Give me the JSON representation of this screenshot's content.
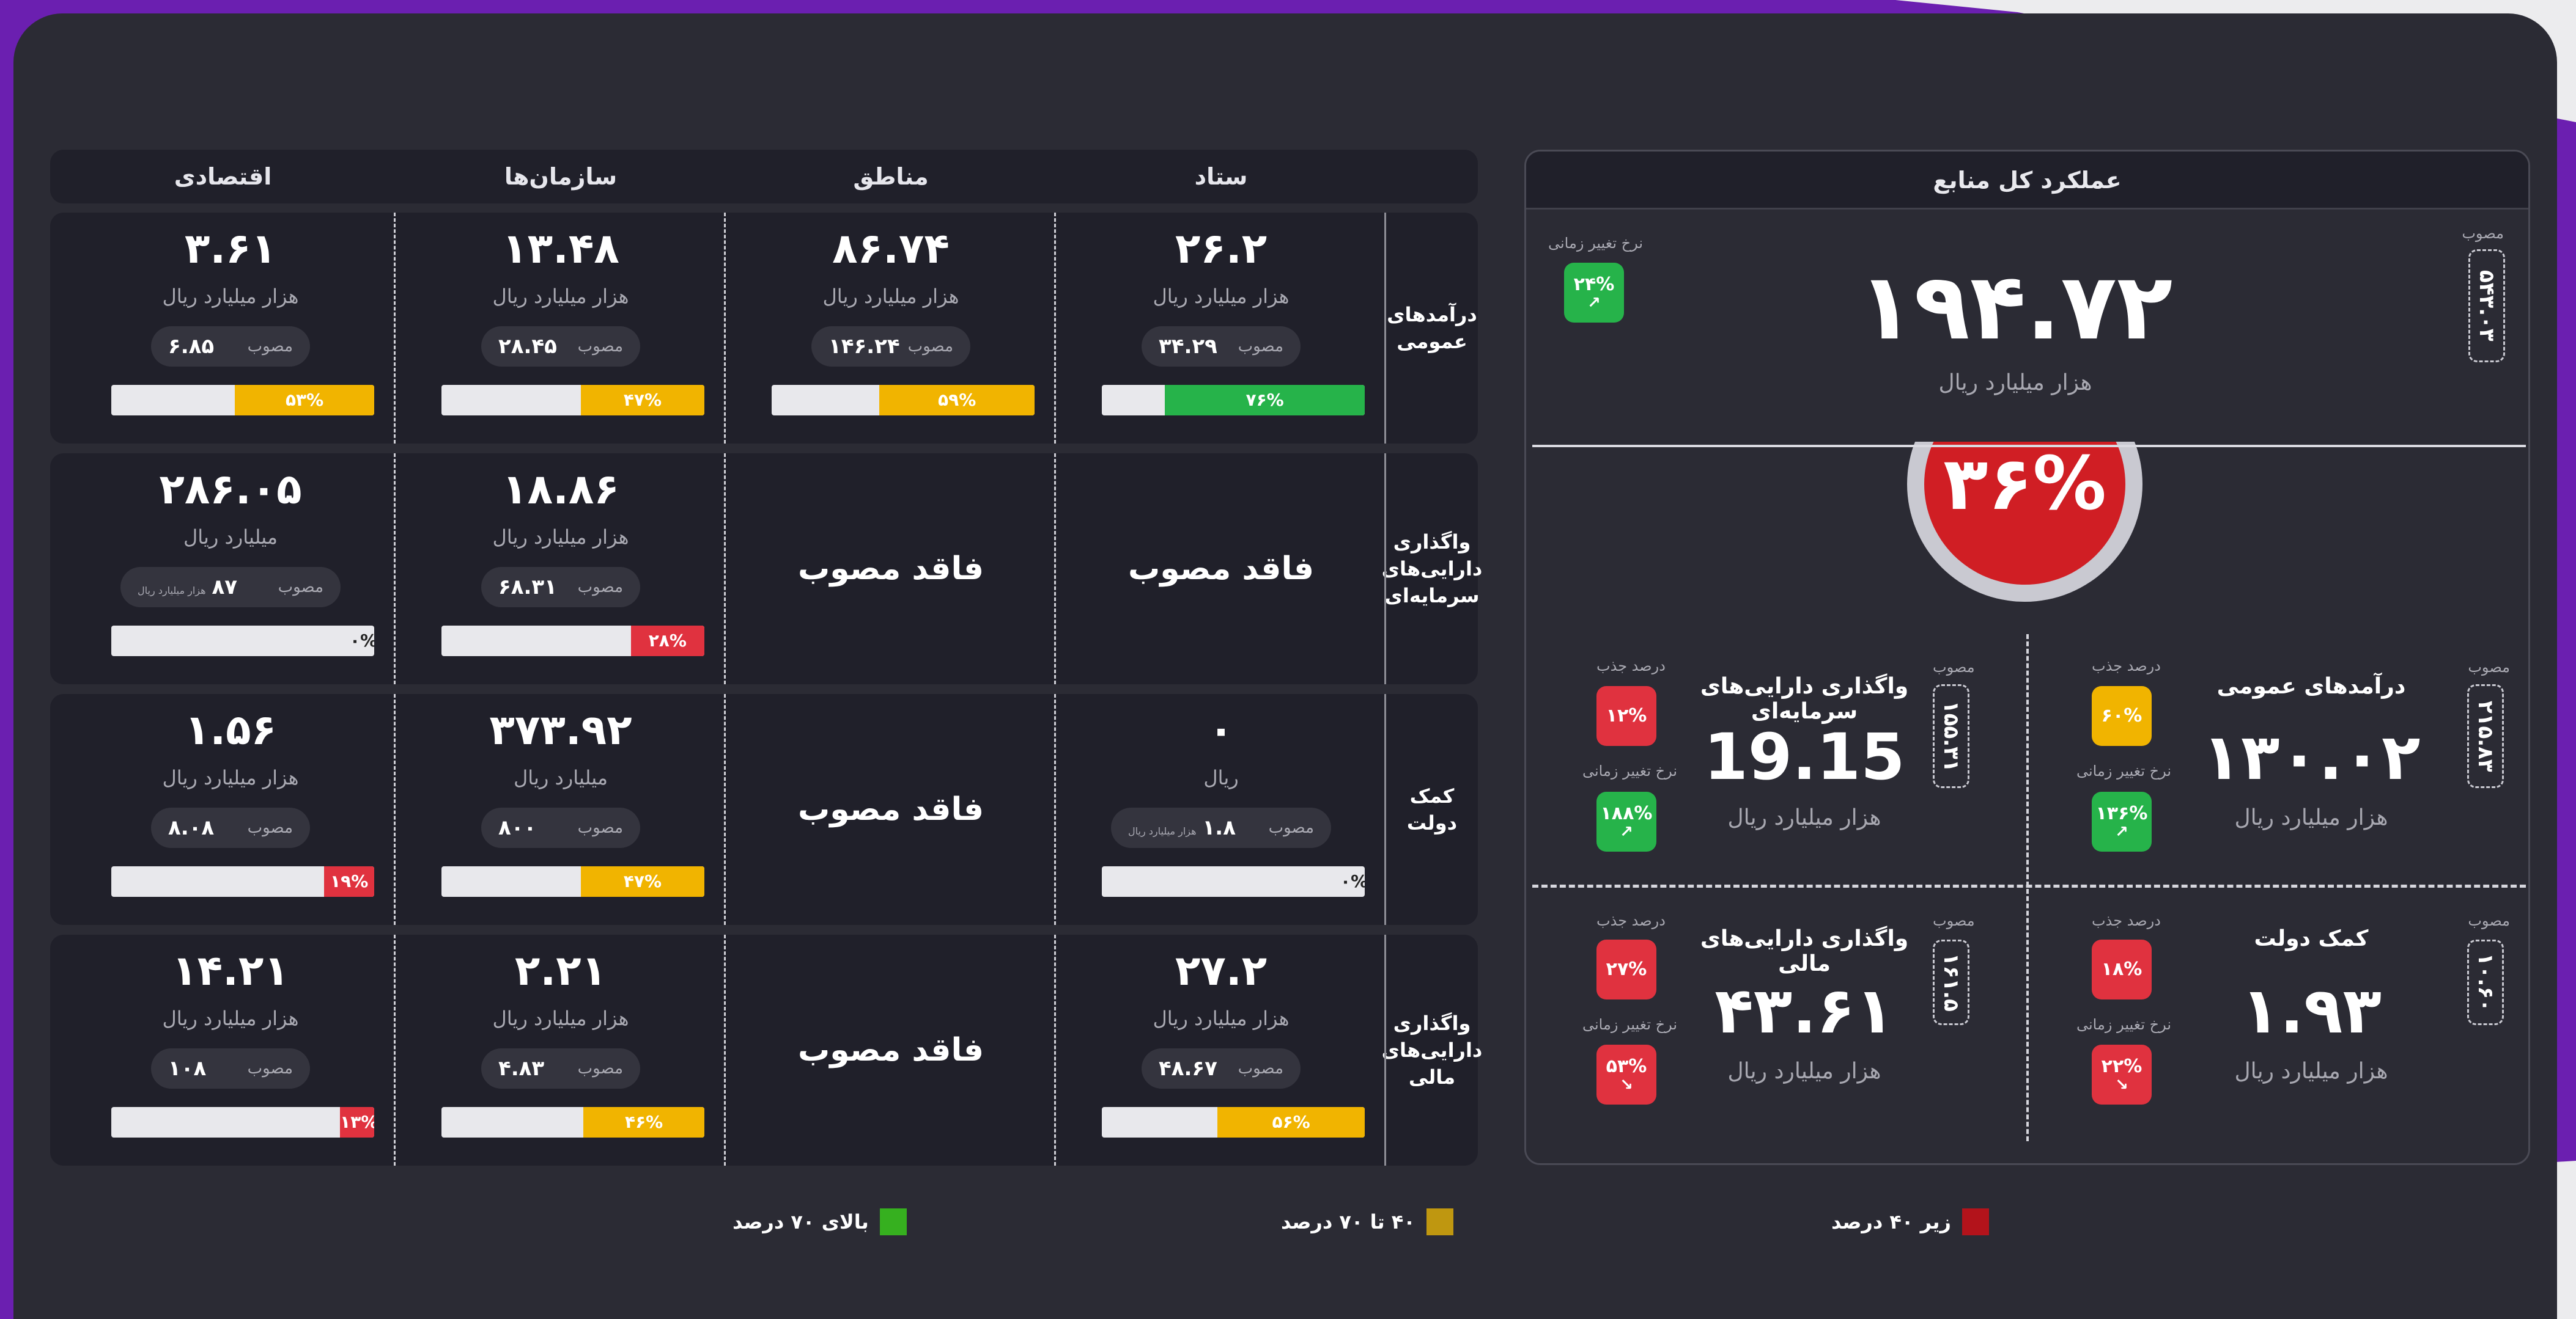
{
  "panel": {
    "title": "عملکرد کل منابع",
    "approved_label": "مصوب",
    "approved_value": "۵۴۳.۰۳",
    "rate_label": "نرخ تغییر زمانی",
    "rate_value": "۲۴%",
    "rate_arrow": "↗",
    "total_value": "۱۹۴.۷۲",
    "total_unit": "هزار میلیارد ریال",
    "gauge_value": "۳۶%",
    "absorb_label": "درصد جذب",
    "quadrants": [
      {
        "title": "درآمدهای عمومی",
        "approved": "۲۱۵.۸۳",
        "value": "۱۳۰.۰۲",
        "unit": "هزار میلیارد ریال",
        "absorb": "۶۰%",
        "absorb_color": "#f1b400",
        "rate": "۱۳۶%",
        "rate_arrow": "↗",
        "rate_color": "#26b34a"
      },
      {
        "title": "واگذاری دارایی‌های سرمایه‌ای",
        "approved": "۱۵۵.۳۱",
        "value": "19.15",
        "unit": "هزار میلیارد ریال",
        "absorb": "۱۲%",
        "absorb_color": "#e0323f",
        "rate": "۱۸۸%",
        "rate_arrow": "↗",
        "rate_color": "#26b34a"
      },
      {
        "title": "کمک دولت",
        "approved": "۱۰.۶۰",
        "value": "۱.۹۳",
        "unit": "هزار میلیارد ریال",
        "absorb": "۱۸%",
        "absorb_color": "#e0323f",
        "rate": "۲۲%",
        "rate_arrow": "↘",
        "rate_color": "#e0323f"
      },
      {
        "title": "واگذاری دارایی‌های مالی",
        "approved": "۱۶۱.۵",
        "value": "۴۳.۶۱",
        "unit": "هزار میلیارد ریال",
        "absorb": "۲۷%",
        "absorb_color": "#e0323f",
        "rate": "۵۳%",
        "rate_arrow": "↘",
        "rate_color": "#e0323f"
      }
    ]
  },
  "table": {
    "columns": [
      "ستاد",
      "مناطق",
      "سازمان‌ها",
      "اقتصادی"
    ],
    "approved_label": "مصوب",
    "no_data": "فاقد مصوب",
    "rows": [
      {
        "label": "درآمدهای عمومی",
        "cells": [
          {
            "value": "۲۶.۲",
            "unit": "هزار میلیارد ریال",
            "approved": "۳۴.۲۹",
            "approved_unit": "",
            "pct": "۷۶%",
            "fill": 0.76,
            "color": "#26b34a"
          },
          {
            "value": "۸۶.۷۴",
            "unit": "هزار میلیارد ریال",
            "approved": "۱۴۶.۲۴",
            "approved_unit": "",
            "pct": "۵۹%",
            "fill": 0.59,
            "color": "#f1b400"
          },
          {
            "value": "۱۳.۴۸",
            "unit": "هزار میلیارد ریال",
            "approved": "۲۸.۴۵",
            "approved_unit": "",
            "pct": "۴۷%",
            "fill": 0.47,
            "color": "#f1b400"
          },
          {
            "value": "۳.۶۱",
            "unit": "هزار میلیارد ریال",
            "approved": "۶.۸۵",
            "approved_unit": "",
            "pct": "۵۳%",
            "fill": 0.53,
            "color": "#f1b400"
          }
        ]
      },
      {
        "label": "واگذاری دارایی‌های سرمایه‌ای",
        "cells": [
          null,
          null,
          {
            "value": "۱۸.۸۶",
            "unit": "هزار میلیارد ریال",
            "approved": "۶۸.۳۱",
            "approved_unit": "",
            "pct": "۲۸%",
            "fill": 0.28,
            "color": "#e0323f"
          },
          {
            "value": "۲۸۶.۰۵",
            "unit": "میلیارد ریال",
            "approved": "۸۷",
            "approved_unit": "هزار میلیارد ریال",
            "pct": "۰%",
            "fill": 0,
            "color": "#e0323f"
          }
        ]
      },
      {
        "label": "کمک دولت",
        "cells": [
          {
            "value": "۰",
            "unit": "ریال",
            "approved": "۱.۸",
            "approved_unit": "هزار میلیارد ریال",
            "pct": "۰%",
            "fill": 0,
            "color": "#e0323f"
          },
          null,
          {
            "value": "۳۷۳.۹۲",
            "unit": "میلیارد ریال",
            "approved": "۸۰۰",
            "approved_unit": "",
            "pct": "۴۷%",
            "fill": 0.47,
            "color": "#f1b400"
          },
          {
            "value": "۱.۵۶",
            "unit": "هزار میلیارد ریال",
            "approved": "۸.۰۸",
            "approved_unit": "",
            "pct": "۱۹%",
            "fill": 0.19,
            "color": "#e0323f"
          }
        ]
      },
      {
        "label": "واگذاری دارایی‌های مالی",
        "cells": [
          {
            "value": "۲۷.۲",
            "unit": "هزار میلیارد ریال",
            "approved": "۴۸.۶۷",
            "approved_unit": "",
            "pct": "۵۶%",
            "fill": 0.56,
            "color": "#f1b400"
          },
          null,
          {
            "value": "۲.۲۱",
            "unit": "هزار میلیارد ریال",
            "approved": "۴.۸۳",
            "approved_unit": "",
            "pct": "۴۶%",
            "fill": 0.46,
            "color": "#f1b400"
          },
          {
            "value": "۱۴.۲۱",
            "unit": "هزار میلیارد ریال",
            "approved": "۱۰۸",
            "approved_unit": "",
            "pct": "۱۳%",
            "fill": 0.13,
            "color": "#e0323f"
          }
        ]
      }
    ]
  },
  "legend": [
    {
      "label": "زیر ۴۰ درصد",
      "color": "#b3131b"
    },
    {
      "label": "۴۰ تا ۷۰ درصد",
      "color": "#bf9710"
    },
    {
      "label": "بالای ۷۰ درصد",
      "color": "#36b01f"
    }
  ]
}
